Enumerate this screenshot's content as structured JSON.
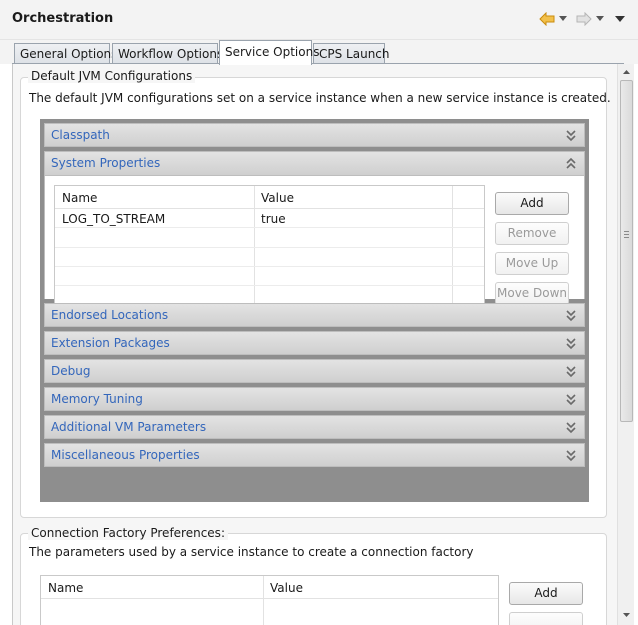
{
  "header": {
    "title": "Orchestration",
    "buttons": [
      {
        "name": "back-icon",
        "label": "Back"
      },
      {
        "name": "forward-icon",
        "label": "Forward"
      },
      {
        "name": "view-menu-icon",
        "label": "View Menu"
      }
    ]
  },
  "tabs": [
    {
      "label": "General Options",
      "active": false
    },
    {
      "label": "Workflow Options",
      "active": false
    },
    {
      "label": "Service Options",
      "active": true
    },
    {
      "label": "CPS Launch",
      "active": false
    }
  ],
  "jvm_group": {
    "title": "Default JVM Configurations",
    "description": "The default JVM configurations set on a service instance when a new service instance is created.",
    "sections": [
      {
        "label": "Classpath",
        "expanded": false
      },
      {
        "label": "System Properties",
        "expanded": true
      },
      {
        "label": "Endorsed Locations",
        "expanded": false
      },
      {
        "label": "Extension Packages",
        "expanded": false
      },
      {
        "label": "Debug",
        "expanded": false
      },
      {
        "label": "Memory Tuning",
        "expanded": false
      },
      {
        "label": "Additional VM Parameters",
        "expanded": false
      },
      {
        "label": "Miscellaneous Properties",
        "expanded": false
      }
    ],
    "system_properties": {
      "columns": [
        "Name",
        "Value"
      ],
      "rows": [
        {
          "name": "LOG_TO_STREAM",
          "value": "true"
        }
      ],
      "buttons": [
        {
          "label": "Add",
          "enabled": true
        },
        {
          "label": "Remove",
          "enabled": false
        },
        {
          "label": "Move Up",
          "enabled": false
        },
        {
          "label": "Move Down",
          "enabled": false
        }
      ]
    }
  },
  "connection_group": {
    "title": "Connection Factory Preferences:",
    "description": "The parameters used by a service instance to create a connection factory",
    "columns": [
      "Name",
      "Value"
    ],
    "buttons": [
      {
        "label": "Add",
        "enabled": true
      }
    ]
  },
  "colors": {
    "section_link": "#3366bb",
    "section_panel_bg": "#8e8e8e",
    "back_arrow": "#e8a317",
    "forward_arrow": "#c8c8c8"
  }
}
